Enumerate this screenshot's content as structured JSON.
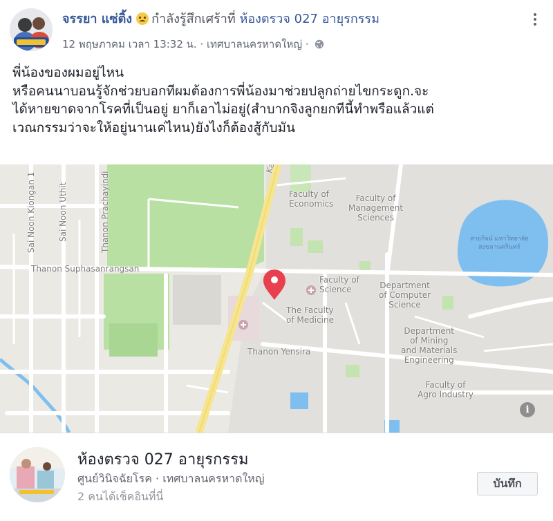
{
  "post": {
    "author_name": "จรรยา แซ่ติ้ง",
    "feeling_text": "กำลังรู้สึกเศร้าที่",
    "place_link": "ห้องตรวจ 027 อายุรกรรม",
    "timestamp": "12 พฤษภาคม เวลา 13:32 น.",
    "separator": "·",
    "location": "เทศบาลนครหาดใหญ่",
    "body_lines": [
      "พี่น้องของผมอยู่ไหน",
      "หรือคนนาบอนรู้จักช่วยบอกทีผมต้องการพี่น้องมาช่วยปลูกถ่ายไขกระดูก.จะ",
      "ได้หายขาดจากโรคที่เป็นอยู่ ยาก็เอาไม่อยู่(สำบากจิงลูกยกทีนี้ทำพรือแล้วแต่",
      "เวณกรรมว่าจะให้อยู่นานเค่ไหน)ยังไงก็ต้องสู้กับมัน"
    ],
    "icons": {
      "feeling": "sad-face-icon",
      "privacy": "globe-icon",
      "more": "more-options-icon",
      "map_pin": "map-pin-icon",
      "map_info": "info-icon"
    }
  },
  "map": {
    "labels": {
      "road_karnjanavanit": "Karnjanavanit R",
      "road_suphasanrangsan": "Thanon Suphasanrangsan",
      "road_yensira": "Thanon Yensira",
      "road_prachayindi": "Thanon Prachayindi",
      "road_klongan": "Sai Noon Kiongan 1",
      "road_noon_uthit": "Sai Noon Uthit",
      "fac_economics": "Faculty of\nEconomics",
      "fac_management": "Faculty of\nManagement\nSciences",
      "fac_science": "Faculty of\nScience",
      "fac_medicine": "The Faculty\nof Medicine",
      "dept_computer": "Department\nof Computer\nScience",
      "dept_mining": "Department\nof Mining\nand Materials\nEngineering",
      "fac_agro": "Faculty of\nAgro Industry",
      "lake_name": "สายกิจน์ มหาวิทยาลัย\nสงขลานครินทร์"
    },
    "info_symbol": "i",
    "colors": {
      "background": "#ebe9e4",
      "park": "#b8e0a3",
      "road_yellow": "#f6e58d",
      "water": "#7fbff0",
      "pin": "#e8404f"
    }
  },
  "place_card": {
    "name": "ห้องตรวจ 027 อายุรกรรม",
    "category": "ศูนย์วินิจฉัยโรค",
    "separator": "·",
    "location": "เทศบาลนครหาดใหญ่",
    "checkins": "2 คนได้เช็คอินที่นี่",
    "save_label": "บันทึก"
  }
}
